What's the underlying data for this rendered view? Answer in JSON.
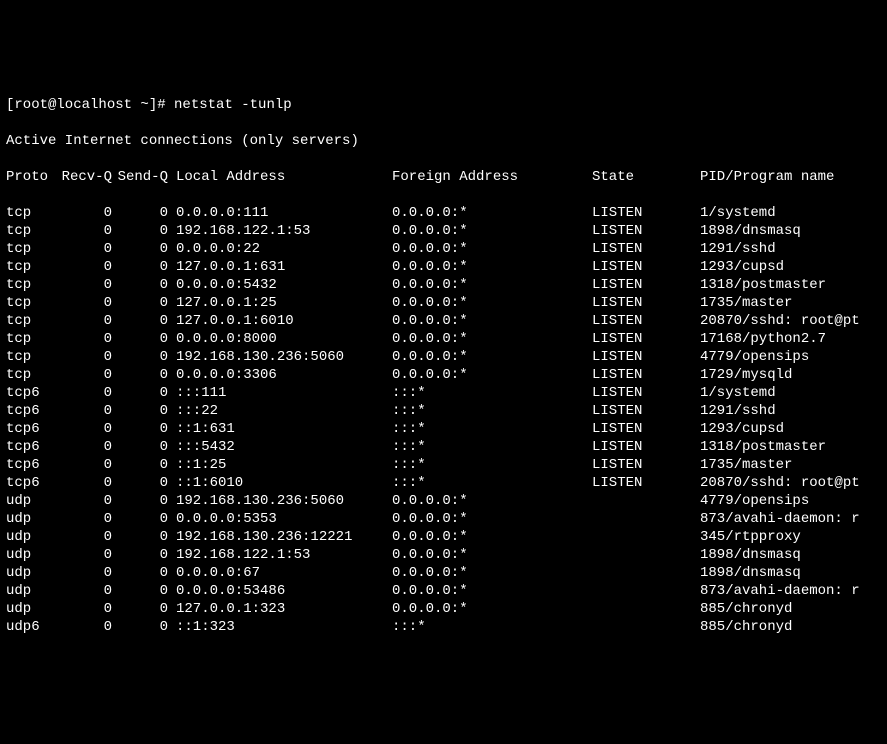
{
  "prompt": "[root@localhost ~]# ",
  "command": "netstat -tunlp",
  "header_line": "Active Internet connections (only servers)",
  "columns": {
    "proto": "Proto",
    "recvq": "Recv-Q",
    "sendq": "Send-Q",
    "local": "Local Address",
    "foreign": "Foreign Address",
    "state": "State",
    "prog": "PID/Program name"
  },
  "rows": [
    {
      "proto": "tcp",
      "recvq": "0",
      "sendq": "0",
      "local": "0.0.0.0:111",
      "foreign": "0.0.0.0:*",
      "state": "LISTEN",
      "prog": "1/systemd"
    },
    {
      "proto": "tcp",
      "recvq": "0",
      "sendq": "0",
      "local": "192.168.122.1:53",
      "foreign": "0.0.0.0:*",
      "state": "LISTEN",
      "prog": "1898/dnsmasq"
    },
    {
      "proto": "tcp",
      "recvq": "0",
      "sendq": "0",
      "local": "0.0.0.0:22",
      "foreign": "0.0.0.0:*",
      "state": "LISTEN",
      "prog": "1291/sshd"
    },
    {
      "proto": "tcp",
      "recvq": "0",
      "sendq": "0",
      "local": "127.0.0.1:631",
      "foreign": "0.0.0.0:*",
      "state": "LISTEN",
      "prog": "1293/cupsd"
    },
    {
      "proto": "tcp",
      "recvq": "0",
      "sendq": "0",
      "local": "0.0.0.0:5432",
      "foreign": "0.0.0.0:*",
      "state": "LISTEN",
      "prog": "1318/postmaster"
    },
    {
      "proto": "tcp",
      "recvq": "0",
      "sendq": "0",
      "local": "127.0.0.1:25",
      "foreign": "0.0.0.0:*",
      "state": "LISTEN",
      "prog": "1735/master"
    },
    {
      "proto": "tcp",
      "recvq": "0",
      "sendq": "0",
      "local": "127.0.0.1:6010",
      "foreign": "0.0.0.0:*",
      "state": "LISTEN",
      "prog": "20870/sshd: root@pt"
    },
    {
      "proto": "tcp",
      "recvq": "0",
      "sendq": "0",
      "local": "0.0.0.0:8000",
      "foreign": "0.0.0.0:*",
      "state": "LISTEN",
      "prog": "17168/python2.7"
    },
    {
      "proto": "tcp",
      "recvq": "0",
      "sendq": "0",
      "local": "192.168.130.236:5060",
      "foreign": "0.0.0.0:*",
      "state": "LISTEN",
      "prog": "4779/opensips"
    },
    {
      "proto": "tcp",
      "recvq": "0",
      "sendq": "0",
      "local": "0.0.0.0:3306",
      "foreign": "0.0.0.0:*",
      "state": "LISTEN",
      "prog": "1729/mysqld"
    },
    {
      "proto": "tcp6",
      "recvq": "0",
      "sendq": "0",
      "local": ":::111",
      "foreign": ":::*",
      "state": "LISTEN",
      "prog": "1/systemd"
    },
    {
      "proto": "tcp6",
      "recvq": "0",
      "sendq": "0",
      "local": ":::22",
      "foreign": ":::*",
      "state": "LISTEN",
      "prog": "1291/sshd"
    },
    {
      "proto": "tcp6",
      "recvq": "0",
      "sendq": "0",
      "local": "::1:631",
      "foreign": ":::*",
      "state": "LISTEN",
      "prog": "1293/cupsd"
    },
    {
      "proto": "tcp6",
      "recvq": "0",
      "sendq": "0",
      "local": ":::5432",
      "foreign": ":::*",
      "state": "LISTEN",
      "prog": "1318/postmaster"
    },
    {
      "proto": "tcp6",
      "recvq": "0",
      "sendq": "0",
      "local": "::1:25",
      "foreign": ":::*",
      "state": "LISTEN",
      "prog": "1735/master"
    },
    {
      "proto": "tcp6",
      "recvq": "0",
      "sendq": "0",
      "local": "::1:6010",
      "foreign": ":::*",
      "state": "LISTEN",
      "prog": "20870/sshd: root@pt"
    },
    {
      "proto": "udp",
      "recvq": "0",
      "sendq": "0",
      "local": "192.168.130.236:5060",
      "foreign": "0.0.0.0:*",
      "state": "",
      "prog": "4779/opensips"
    },
    {
      "proto": "udp",
      "recvq": "0",
      "sendq": "0",
      "local": "0.0.0.0:5353",
      "foreign": "0.0.0.0:*",
      "state": "",
      "prog": "873/avahi-daemon: r"
    },
    {
      "proto": "udp",
      "recvq": "0",
      "sendq": "0",
      "local": "192.168.130.236:12221",
      "foreign": "0.0.0.0:*",
      "state": "",
      "prog": "345/rtpproxy"
    },
    {
      "proto": "udp",
      "recvq": "0",
      "sendq": "0",
      "local": "192.168.122.1:53",
      "foreign": "0.0.0.0:*",
      "state": "",
      "prog": "1898/dnsmasq"
    },
    {
      "proto": "udp",
      "recvq": "0",
      "sendq": "0",
      "local": "0.0.0.0:67",
      "foreign": "0.0.0.0:*",
      "state": "",
      "prog": "1898/dnsmasq"
    },
    {
      "proto": "udp",
      "recvq": "0",
      "sendq": "0",
      "local": "0.0.0.0:53486",
      "foreign": "0.0.0.0:*",
      "state": "",
      "prog": "873/avahi-daemon: r"
    },
    {
      "proto": "udp",
      "recvq": "0",
      "sendq": "0",
      "local": "127.0.0.1:323",
      "foreign": "0.0.0.0:*",
      "state": "",
      "prog": "885/chronyd"
    },
    {
      "proto": "udp6",
      "recvq": "0",
      "sendq": "0",
      "local": "::1:323",
      "foreign": ":::*",
      "state": "",
      "prog": "885/chronyd"
    }
  ]
}
